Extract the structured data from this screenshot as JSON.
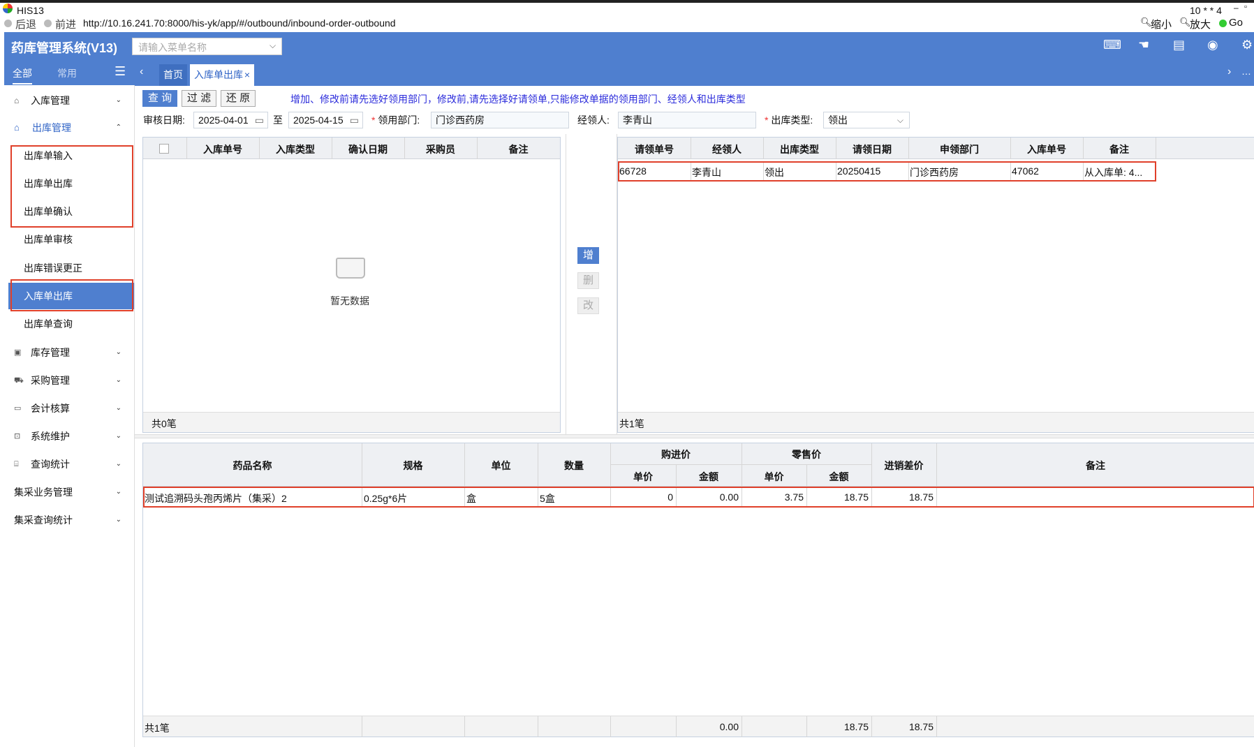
{
  "window": {
    "title": "HIS13",
    "right_info": "10 * * 4"
  },
  "nav": {
    "back": "后退",
    "forward": "前进",
    "url": "http://10.16.241.70:8000/his-yk/app/#/outbound/inbound-order-outbound",
    "zoom_out": "缩小",
    "zoom_in": "放大",
    "go": "Go"
  },
  "app": {
    "title": "药库管理系统(V13)",
    "menu_search_placeholder": "请输入菜单名称"
  },
  "sidebar": {
    "tabs": [
      "全部",
      "常用"
    ],
    "groups": [
      {
        "label": "入库管理"
      },
      {
        "label": "出库管理"
      }
    ],
    "sub_items": [
      "出库单输入",
      "出库单出库",
      "出库单确认",
      "出库单审核",
      "出库错误更正",
      "入库单出库",
      "出库单查询"
    ],
    "groups_after": [
      "库存管理",
      "采购管理",
      "会计核算",
      "系统维护",
      "查询统计",
      "集采业务管理",
      "集采查询统计"
    ]
  },
  "tabs": {
    "home": "首页",
    "active": "入库单出库"
  },
  "toolbar": {
    "query": "查 询",
    "filter": "过 滤",
    "restore": "还 原",
    "hint": "增加、修改前请先选好领用部门，修改前,请先选择好请领单,只能修改单据的领用部门、经领人和出库类型"
  },
  "filters": {
    "audit_date_label": "审核日期:",
    "date_from": "2025-04-01",
    "to_label": "至",
    "date_to": "2025-04-15",
    "dept_label": "领用部门:",
    "dept_value": "门诊西药房",
    "handler_label": "经领人:",
    "handler_value": "李青山",
    "type_label": "出库类型:",
    "type_value": "领出"
  },
  "left_grid": {
    "columns": [
      "入库单号",
      "入库类型",
      "确认日期",
      "采购员",
      "备注"
    ],
    "empty_text": "暂无数据",
    "footer": "共0笔"
  },
  "mid_buttons": {
    "add": "增",
    "del": "删",
    "edit": "改"
  },
  "right_grid": {
    "columns": [
      "请领单号",
      "经领人",
      "出库类型",
      "请领日期",
      "申领部门",
      "入库单号",
      "备注"
    ],
    "rows": [
      [
        "66728",
        "李青山",
        "领出",
        "20250415",
        "门诊西药房",
        "47062",
        "从入库单: 4..."
      ]
    ],
    "footer": "共1笔"
  },
  "bottom_grid": {
    "columns": {
      "name": "药品名称",
      "spec": "规格",
      "unit": "单位",
      "qty": "数量",
      "purchase": "购进价",
      "retail": "零售价",
      "unit_price": "单价",
      "amount": "金额",
      "diff": "进销差价",
      "remark": "备注"
    },
    "rows": [
      [
        "测试追溯码头孢丙烯片（集采）2",
        "0.25g*6片",
        "盒",
        "5盒",
        "0",
        "0.00",
        "3.75",
        "18.75",
        "18.75",
        ""
      ]
    ],
    "footer": {
      "count": "共1笔",
      "purchase_amount": "0.00",
      "retail_amount": "18.75",
      "diff": "18.75"
    }
  }
}
